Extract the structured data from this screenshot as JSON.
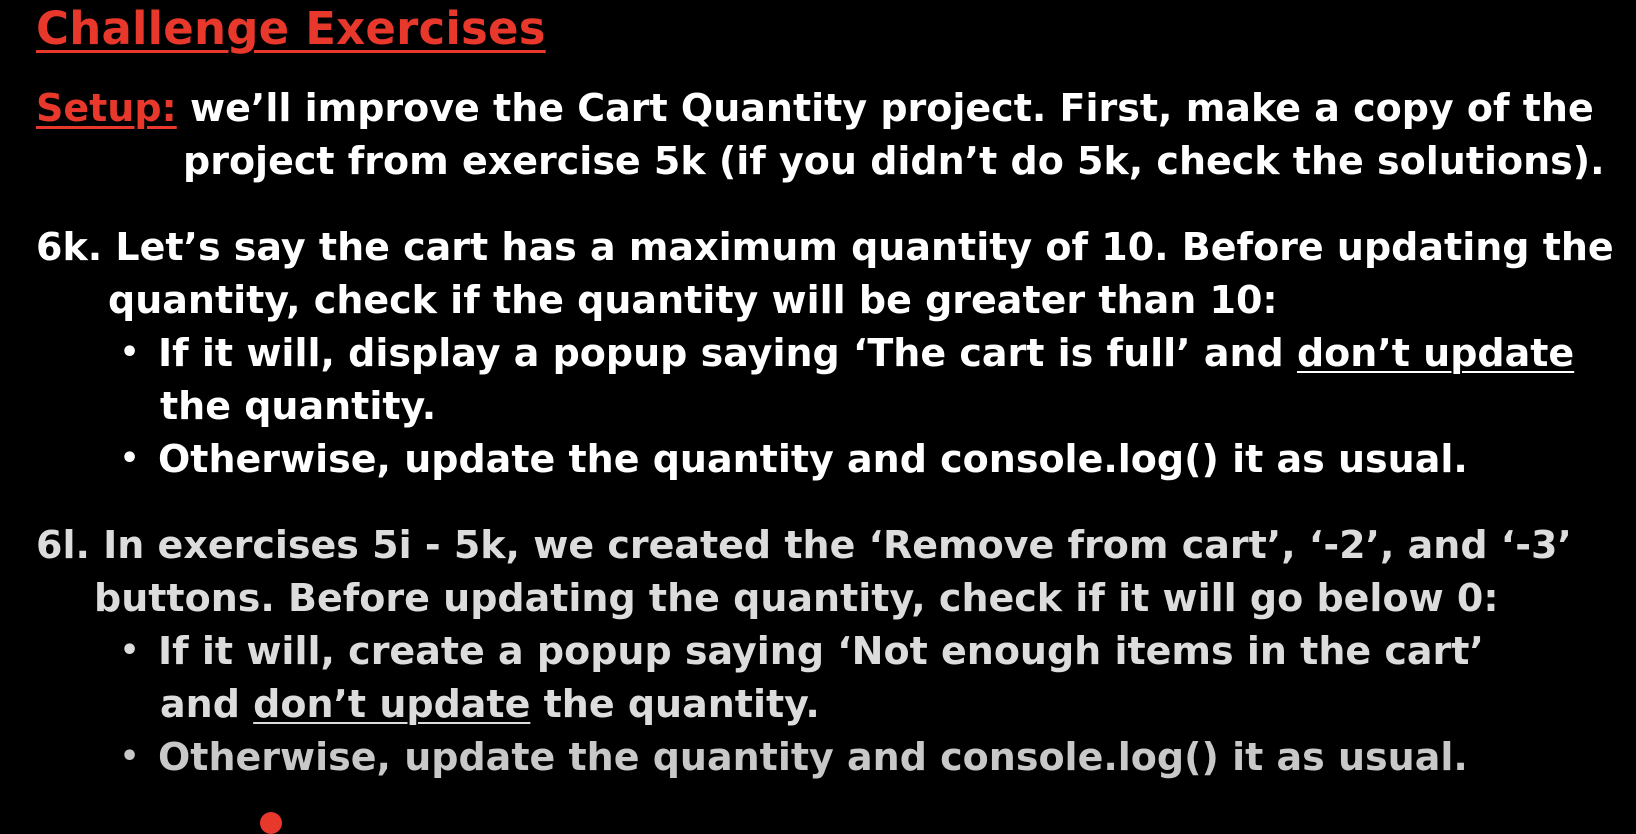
{
  "title": "Challenge Exercises",
  "setup": {
    "label": "Setup:",
    "line1": "we’ll improve the Cart Quantity project. First, make a copy of the",
    "line2": "project from exercise 5k (if you didn’t do 5k, check the solutions)."
  },
  "ex6k": {
    "line1": "6k. Let’s say the cart has a maximum quantity of 10. Before updating the",
    "line2": "quantity, check if the quantity will be greater than 10:",
    "bullet1_pre": "If it will, display a popup saying ‘The cart is full’ and ",
    "bullet1_u": "don’t update",
    "bullet1_cont": "the quantity.",
    "bullet2": "Otherwise, update the quantity and console.log() it as usual."
  },
  "ex6l": {
    "line1": "6l. In exercises 5i - 5k, we created the ‘Remove from cart’, ‘-2’, and ‘-3’",
    "line2": "buttons. Before updating the quantity, check if it will go below 0:",
    "bullet1": "If it will, create a popup saying ‘Not enough items in the cart’",
    "bullet1_cont_pre": "and ",
    "bullet1_cont_u": "don’t update",
    "bullet1_cont_post": " the quantity.",
    "bullet2": "Otherwise, update the quantity and console.log() it as usual."
  },
  "bullet_glyph": "•",
  "colors": {
    "background": "#000000",
    "accent": "#e8382c",
    "text": "#ffffff"
  }
}
